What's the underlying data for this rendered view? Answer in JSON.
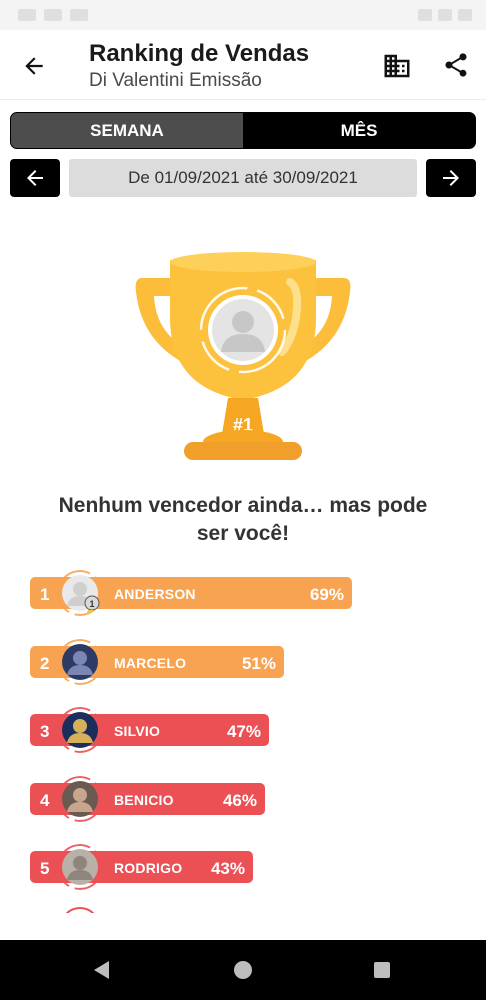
{
  "header": {
    "title": "Ranking de Vendas",
    "subtitle": "Di Valentini Emissão"
  },
  "tabs": [
    {
      "label": "SEMANA",
      "active": false
    },
    {
      "label": "MÊS",
      "active": true
    }
  ],
  "period": {
    "range_label": "De 01/09/2021 até 30/09/2021"
  },
  "trophy": {
    "badge": "#1"
  },
  "empty_message": "Nenhum vencedor ainda… mas pode ser você!",
  "ranking": [
    {
      "position": "1",
      "name": "ANDERSON",
      "percent": "69%",
      "color": "#f7a352"
    },
    {
      "position": "2",
      "name": "MARCELO",
      "percent": "51%",
      "color": "#f7a352"
    },
    {
      "position": "3",
      "name": "SILVIO",
      "percent": "47%",
      "color": "#eb5055"
    },
    {
      "position": "4",
      "name": "BENICIO",
      "percent": "46%",
      "color": "#eb5055"
    },
    {
      "position": "5",
      "name": "RODRIGO",
      "percent": "43%",
      "color": "#eb5055"
    }
  ],
  "colors": {
    "accent_orange": "#f7a352",
    "accent_red": "#eb5055",
    "trophy_gold": "#fcc13d"
  }
}
